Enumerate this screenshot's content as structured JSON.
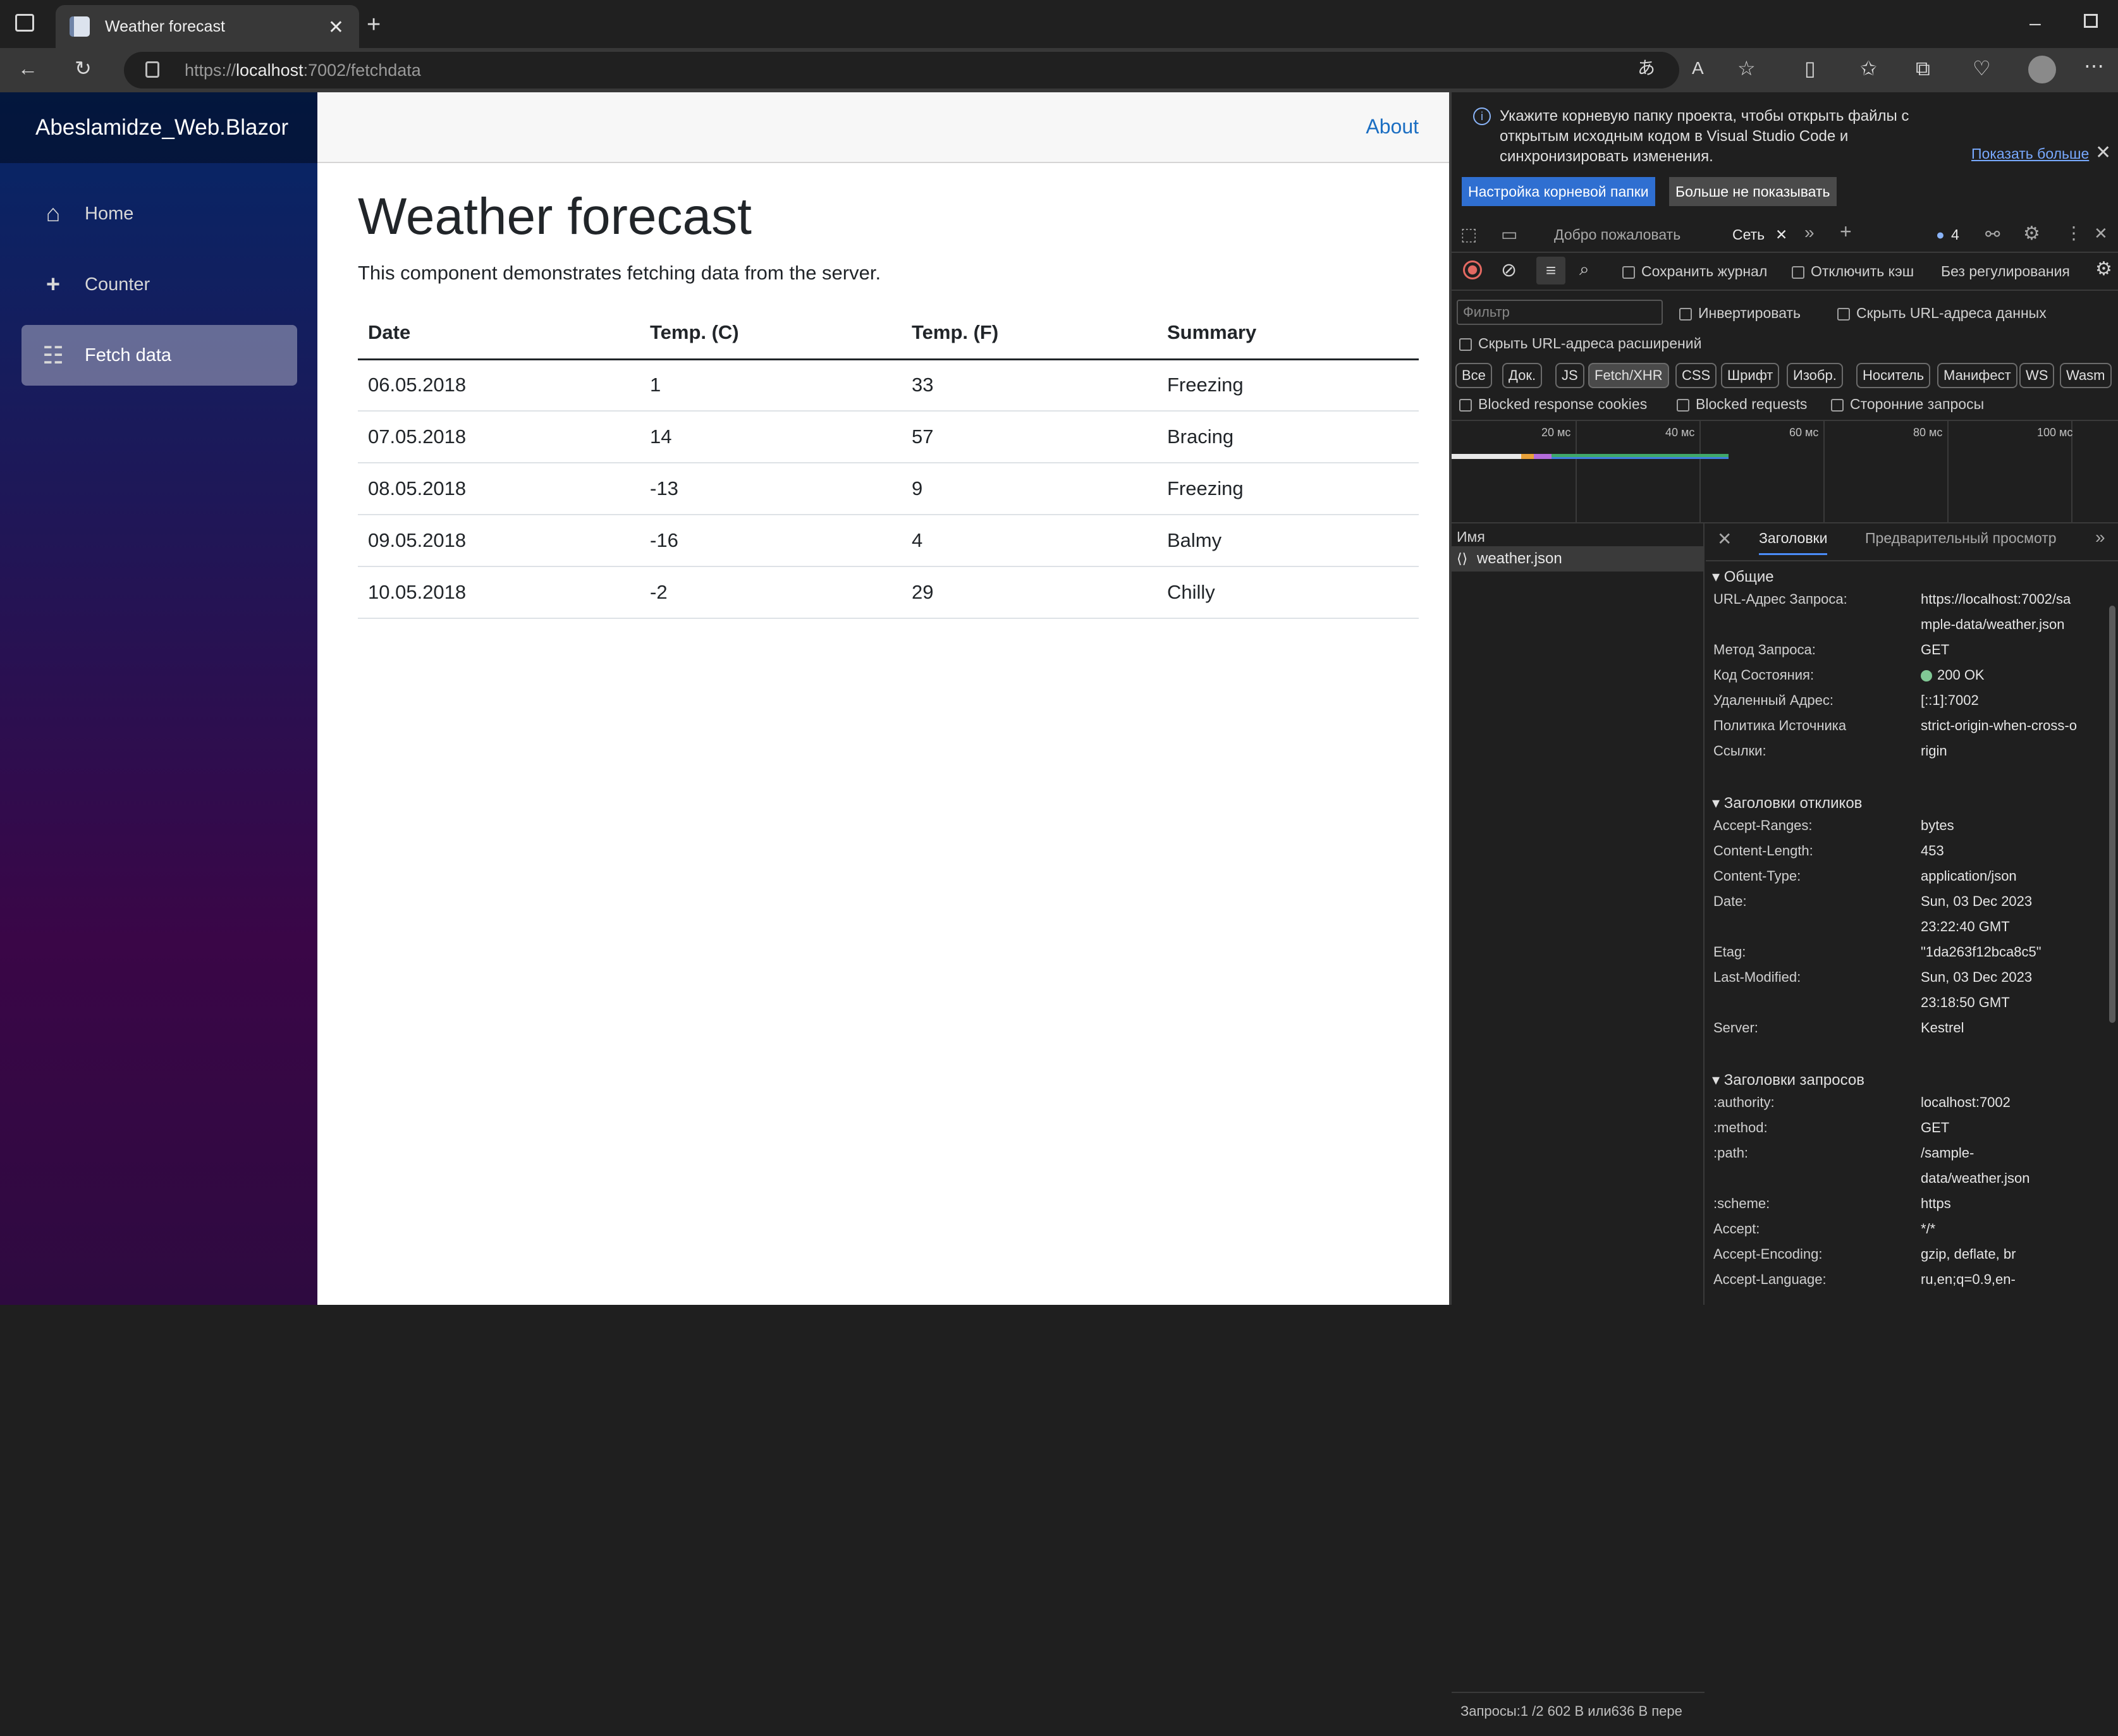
{
  "browser": {
    "tab_title": "Weather forecast",
    "url_prefix": "https://",
    "url_host": "localhost",
    "url_rest": ":7002/fetchdata"
  },
  "app": {
    "brand": "Abeslamidze_Web.Blazor",
    "nav": [
      {
        "label": "Home",
        "icon": "home-icon"
      },
      {
        "label": "Counter",
        "icon": "plus-icon"
      },
      {
        "label": "Fetch data",
        "icon": "list-icon"
      }
    ],
    "about": "About",
    "title": "Weather forecast",
    "lead": "This component demonstrates fetching data from the server.",
    "columns": [
      "Date",
      "Temp. (C)",
      "Temp. (F)",
      "Summary"
    ],
    "rows": [
      [
        "06.05.2018",
        "1",
        "33",
        "Freezing"
      ],
      [
        "07.05.2018",
        "14",
        "57",
        "Bracing"
      ],
      [
        "08.05.2018",
        "-13",
        "9",
        "Freezing"
      ],
      [
        "09.05.2018",
        "-16",
        "4",
        "Balmy"
      ],
      [
        "10.05.2018",
        "-2",
        "29",
        "Chilly"
      ]
    ]
  },
  "devtools": {
    "info": "Укажите корневую папку проекта, чтобы открыть файлы с открытым исходным кодом в Visual Studio Code и синхронизировать изменения.",
    "show_more": "Показать больше",
    "btn_root": "Настройка корневой папки",
    "btn_dont": "Больше не показывать",
    "tab_welcome": "Добро пожаловать",
    "tab_network": "Сеть",
    "issues_count": "4",
    "preserve_log": "Сохранить журнал",
    "disable_cache": "Отключить кэш",
    "throttling": "Без регулирования",
    "filter_placeholder": "Фильтр",
    "invert": "Инвертировать",
    "hide_data_urls": "Скрыть URL-адреса данных",
    "hide_ext_urls": "Скрыть URL-адреса расширений",
    "types": [
      "Все",
      "Док.",
      "JS",
      "Fetch/XHR",
      "CSS",
      "Шрифт",
      "Изобр.",
      "Носитель",
      "Манифест",
      "WS",
      "Wasm"
    ],
    "blocked_cookies": "Blocked response cookies",
    "blocked_requests": "Blocked requests",
    "third_party": "Сторонние запросы",
    "ticks": [
      "20 мс",
      "40 мс",
      "60 мс",
      "80 мс",
      "100 мс"
    ],
    "name_header": "Имя",
    "request_name": "weather.json",
    "hdr_tab_headers": "Заголовки",
    "hdr_tab_preview": "Предварительный просмотр",
    "general_title": "Общие",
    "general": [
      [
        "URL-Адрес Запроса:",
        "https://localhost:7002/sa"
      ],
      [
        "",
        "mple-data/weather.json"
      ],
      [
        "Метод Запроса:",
        "GET"
      ],
      [
        "Код Состояния:",
        "200 OK"
      ],
      [
        "Удаленный Адрес:",
        "[::1]:7002"
      ],
      [
        "Политика Источника",
        "strict-origin-when-cross-o"
      ],
      [
        "Ссылки:",
        "rigin"
      ]
    ],
    "resp_title": "Заголовки откликов",
    "resp": [
      [
        "Accept-Ranges:",
        "bytes"
      ],
      [
        "Content-Length:",
        "453"
      ],
      [
        "Content-Type:",
        "application/json"
      ],
      [
        "Date:",
        "Sun, 03 Dec 2023"
      ],
      [
        "",
        "23:22:40 GMT"
      ],
      [
        "Etag:",
        "\"1da263f12bca8c5\""
      ],
      [
        "Last-Modified:",
        "Sun, 03 Dec 2023"
      ],
      [
        "",
        "23:18:50 GMT"
      ],
      [
        "Server:",
        "Kestrel"
      ]
    ],
    "req_title": "Заголовки запросов",
    "req": [
      [
        ":authority:",
        "localhost:7002"
      ],
      [
        ":method:",
        "GET"
      ],
      [
        ":path:",
        "/sample-"
      ],
      [
        "",
        "data/weather.json"
      ],
      [
        ":scheme:",
        "https"
      ],
      [
        "Accept:",
        "*/*"
      ],
      [
        "Accept-Encoding:",
        "gzip, deflate, br"
      ],
      [
        "Accept-Language:",
        "ru,en;q=0.9,en-"
      ]
    ],
    "status": "Запросы:1 /2   602 B или636 B пере"
  }
}
